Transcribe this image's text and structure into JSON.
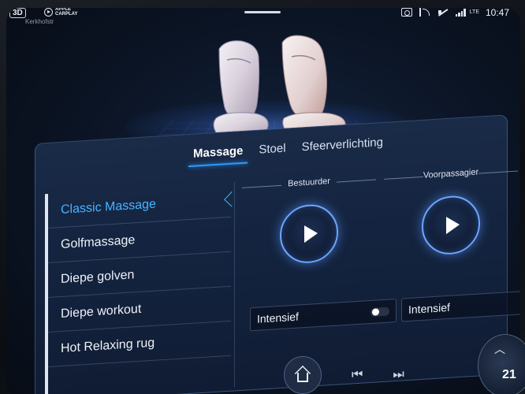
{
  "status": {
    "view_badge": "3D",
    "carplay_label": "APPLE CARPLAY",
    "street": "Kerkhofstr",
    "icons": [
      "camera-icon",
      "antenna-icon",
      "mute-icon",
      "signal-icon"
    ],
    "network": "LTE",
    "time": "10:47"
  },
  "tabs": [
    {
      "label": "Massage",
      "active": true
    },
    {
      "label": "Stoel",
      "active": false
    },
    {
      "label": "Sfeerverlichting",
      "active": false
    }
  ],
  "massage_programs": [
    {
      "label": "Classic Massage",
      "selected": true
    },
    {
      "label": "Golfmassage",
      "selected": false
    },
    {
      "label": "Diepe golven",
      "selected": false
    },
    {
      "label": "Diepe workout",
      "selected": false
    },
    {
      "label": "Hot Relaxing rug",
      "selected": false
    }
  ],
  "driver": {
    "header": "Bestuurder",
    "play_icon": "play-icon",
    "intensity_label": "Intensief",
    "intensity_on": false
  },
  "passenger": {
    "header": "Voorpassagier",
    "play_icon": "play-icon",
    "intensity_label": "Intensief",
    "intensity_on": true
  },
  "bottom": {
    "home_icon": "home-icon",
    "prev_icon": "skip-previous-icon",
    "next_icon": "skip-next-icon",
    "climate_temp": "21",
    "climate_icon": "chevron-up-icon"
  },
  "colors": {
    "accent": "#2b9bff",
    "selected_text": "#47b3ff",
    "panel": "#142440"
  }
}
